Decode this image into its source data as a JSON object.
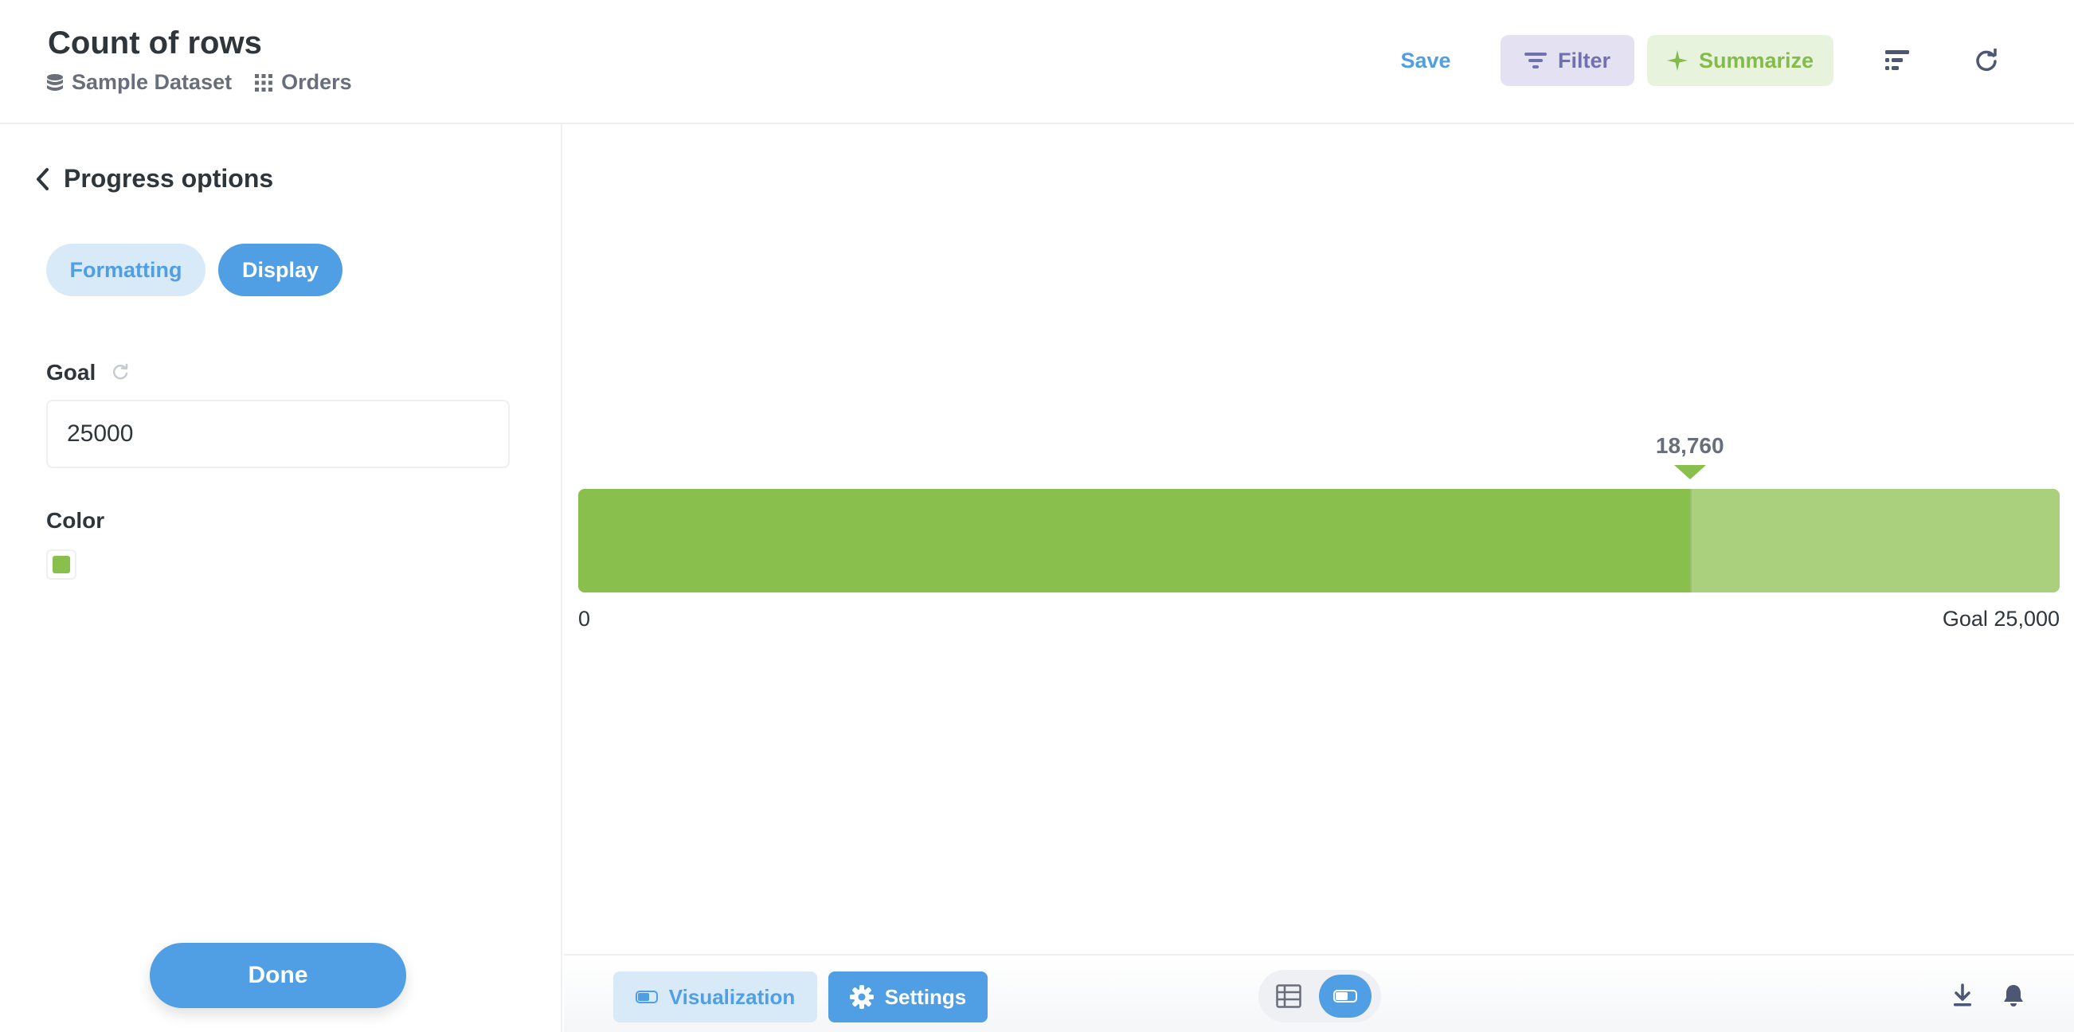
{
  "header": {
    "title": "Count of rows",
    "breadcrumbs": [
      {
        "label": "Sample Dataset",
        "icon": "database-icon"
      },
      {
        "label": "Orders",
        "icon": "table-grid-icon"
      }
    ],
    "save_label": "Save",
    "filter_label": "Filter",
    "summarize_label": "Summarize"
  },
  "sidebar": {
    "heading": "Progress options",
    "tabs": [
      {
        "label": "Formatting",
        "active": false
      },
      {
        "label": "Display",
        "active": true
      }
    ],
    "goal_label": "Goal",
    "goal_value": "25000",
    "color_label": "Color",
    "color_value": "#88bf4d",
    "done_label": "Done"
  },
  "progress": {
    "value": 18760,
    "value_label": "18,760",
    "goal": 25000,
    "min_label": "0",
    "goal_label": "Goal 25,000",
    "fill_color": "#88bf4d",
    "remaining_color": "#aad07d"
  },
  "footer": {
    "visualization_label": "Visualization",
    "settings_label": "Settings"
  },
  "colors": {
    "brand": "#509ee3",
    "filter": "#7172ad",
    "summarize": "#84bb4c"
  }
}
